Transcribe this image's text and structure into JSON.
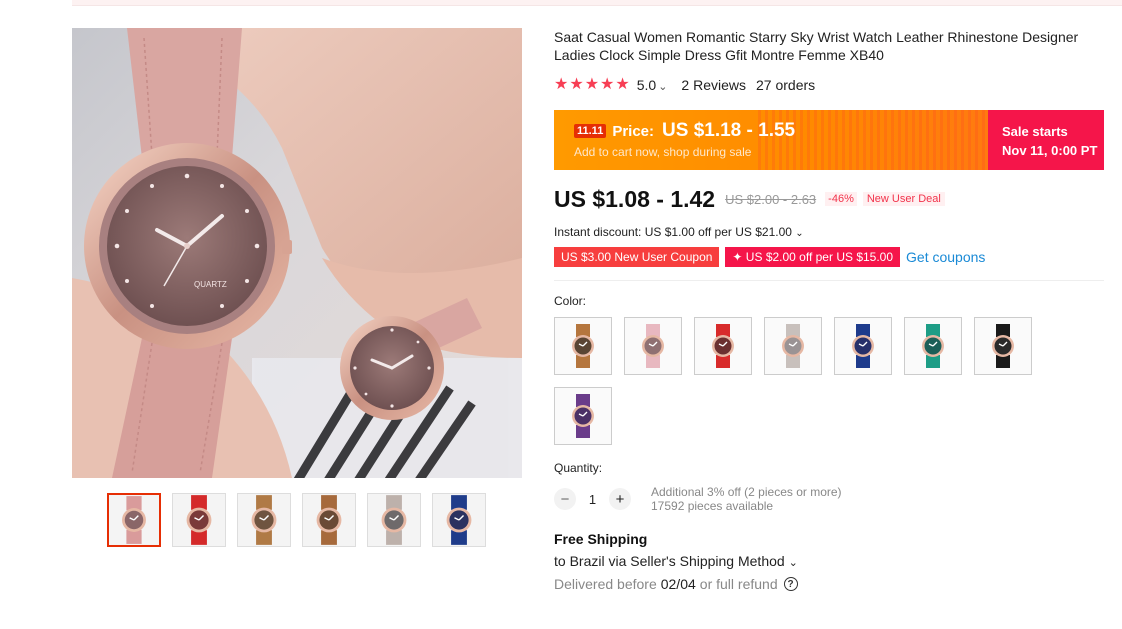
{
  "product": {
    "title": "Saat Casual Women Romantic Starry Sky Wrist Watch Leather Rhinestone Designer Ladies Clock Simple Dress Gfit Montre Femme XB40",
    "rating": "5.0",
    "reviews": "2 Reviews",
    "orders": "27 orders",
    "stars": 5
  },
  "gallery": {
    "main_image_desc": "pink starry watch on wrist",
    "dial_brand": "QUARTZ",
    "thumbs": [
      {
        "strap": "#d99b9b",
        "dial": "#8a6668"
      },
      {
        "strap": "#d42a2a",
        "dial": "#7a3a3a"
      },
      {
        "strap": "#b07a45",
        "dial": "#6f5440"
      },
      {
        "strap": "#a66a3c",
        "dial": "#6a4a36"
      },
      {
        "strap": "#bdb1ab",
        "dial": "#6e6a6b"
      },
      {
        "strap": "#1f3c8a",
        "dial": "#2b3260"
      }
    ]
  },
  "promo": {
    "badge": "11.11",
    "label": "Price:",
    "price": "US $1.18 - 1.55",
    "sub": "Add to cart now, shop during sale",
    "starts_line1": "Sale starts",
    "starts_line2": "Nov 11, 0:00 PT"
  },
  "pricing": {
    "price": "US $1.08 - 1.42",
    "original": "US $2.00 - 2.63",
    "discount": "-46%",
    "deal": "New User Deal",
    "instant": "Instant discount: US $1.00 off per US $21.00",
    "coupon1": "US $3.00 New User Coupon",
    "coupon2": "✦ US $2.00 off per US $15.00",
    "get_coupons": "Get coupons"
  },
  "color": {
    "label": "Color:",
    "options": [
      {
        "strap": "#b5763e",
        "dial": "#5a4534"
      },
      {
        "strap": "#e8b8c0",
        "dial": "#8f7072"
      },
      {
        "strap": "#d82b2b",
        "dial": "#6b3030"
      },
      {
        "strap": "#c8c0bc",
        "dial": "#9a9394"
      },
      {
        "strap": "#1e3b8c",
        "dial": "#27306a"
      },
      {
        "strap": "#1d9d86",
        "dial": "#1c5f58"
      },
      {
        "strap": "#1a1a1a",
        "dial": "#2a2a2a"
      },
      {
        "strap": "#6a3c8a",
        "dial": "#4b3166"
      }
    ]
  },
  "quantity": {
    "label": "Quantity:",
    "value": "1",
    "minus": "−",
    "plus": "+",
    "note1": "Additional 3% off (2 pieces or more)",
    "note2": "17592 pieces available"
  },
  "shipping": {
    "title": "Free Shipping",
    "dest": "to Brazil via Seller's Shipping Method",
    "deliver_pre": "Delivered before",
    "deliver_date": "02/04",
    "deliver_post": "or full refund",
    "help": "?"
  },
  "icons": {
    "star": "★",
    "chevron": "⌄"
  }
}
